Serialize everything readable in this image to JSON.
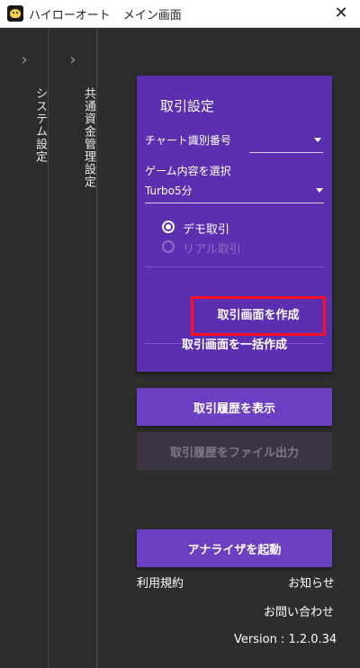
{
  "window": {
    "title": "ハイローオート",
    "subtitle": "メイン画面",
    "close_glyph": "✕"
  },
  "side_panels": [
    {
      "label": "システム設定",
      "chevron": "›"
    },
    {
      "label": "共通資金管理設定",
      "chevron": "›"
    }
  ],
  "card": {
    "title": "取引設定",
    "chart_id_label": "チャート識別番号",
    "chart_id_value": "",
    "game_label": "ゲーム内容を選択",
    "game_value": "Turbo5分",
    "radio_demo": "デモ取引",
    "radio_real": "リアル取引",
    "radio_selected": "demo",
    "create_button": "取引画面を作成",
    "bulk_create_button": "取引画面を一括作成"
  },
  "buttons": {
    "history": "取引履歴を表示",
    "export": "取引履歴をファイル出力",
    "analyzer": "アナライザを起動"
  },
  "footer": {
    "terms": "利用規約",
    "news": "お知らせ",
    "contact": "お問い合わせ",
    "version": "Version : 1.2.0.34"
  },
  "colors": {
    "card": "#5b2fb0",
    "button": "#6a3fc2",
    "highlight": "#ff0f1f",
    "background": "#2e2e2e"
  }
}
